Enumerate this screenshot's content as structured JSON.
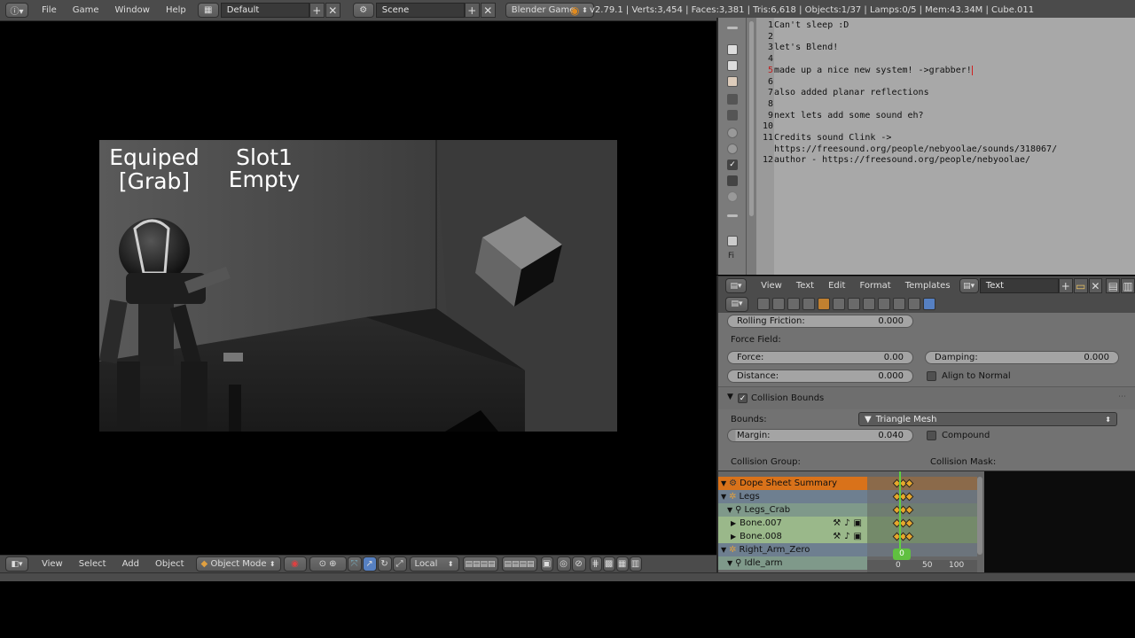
{
  "topbar": {
    "menus": [
      "File",
      "Game",
      "Window",
      "Help"
    ],
    "layout": "Default",
    "scene": "Scene",
    "engine": "Blender Game",
    "stats": "v2.79.1 | Verts:3,454 | Faces:3,381 | Tris:6,618 | Objects:1/37 | Lamps:0/5 | Mem:43.34M | Cube.011"
  },
  "game_view": {
    "hud_equipped_line1": "Equiped",
    "hud_equipped_line2": "[Grab]",
    "hud_slot_line1": "Slot1",
    "hud_slot_line2": "Empty"
  },
  "view_header": {
    "menus": [
      "View",
      "Select",
      "Add",
      "Object"
    ],
    "mode": "Object Mode",
    "orientation": "Local"
  },
  "text_editor": {
    "lines": [
      {
        "num": "1",
        "text": "Can't sleep :D"
      },
      {
        "num": "2",
        "text": ""
      },
      {
        "num": "3",
        "text": "let's Blend!"
      },
      {
        "num": "4",
        "text": ""
      },
      {
        "num": "5",
        "text": "made up a nice new system! ->grabber!"
      },
      {
        "num": "6",
        "text": ""
      },
      {
        "num": "7",
        "text": "also added planar reflections"
      },
      {
        "num": "8",
        "text": ""
      },
      {
        "num": "9",
        "text": "next lets add some sound eh?"
      },
      {
        "num": "10",
        "text": ""
      },
      {
        "num": "11",
        "text": "Credits sound Clink ->"
      },
      {
        "num": "",
        "text": "https://freesound.org/people/nebyoolae/sounds/318067/"
      },
      {
        "num": "12",
        "text": "author - https://freesound.org/people/nebyoolae/"
      }
    ],
    "sidebar_label": "Fi",
    "header_menus": [
      "View",
      "Text",
      "Edit",
      "Format",
      "Templates"
    ],
    "datablock": "Text"
  },
  "properties": {
    "rolling_friction": {
      "label": "Rolling Friction:",
      "value": "0.000"
    },
    "force_field_label": "Force Field:",
    "force": {
      "label": "Force:",
      "value": "0.00"
    },
    "damping": {
      "label": "Damping:",
      "value": "0.000"
    },
    "distance": {
      "label": "Distance:",
      "value": "0.000"
    },
    "align_to_normal": "Align to Normal",
    "collision_bounds": "Collision Bounds",
    "bounds_label": "Bounds:",
    "bounds_value": "Triangle Mesh",
    "margin": {
      "label": "Margin:",
      "value": "0.040"
    },
    "compound": "Compound",
    "collision_group": "Collision Group:",
    "collision_mask": "Collision Mask:"
  },
  "dopesheet": {
    "rows": [
      {
        "label": "Dope Sheet Summary"
      },
      {
        "label": "Legs"
      },
      {
        "label": "Legs_Crab"
      },
      {
        "label": "Bone.007"
      },
      {
        "label": "Bone.008"
      },
      {
        "label": "Right_Arm_Zero"
      },
      {
        "label": "Idle_arm"
      }
    ],
    "current_frame": "0",
    "ruler": [
      "0",
      "50",
      "100"
    ]
  },
  "colors": {
    "accent_orange": "#e08a1e",
    "bg_dark": "#4b4b4b",
    "editor_bg": "#a8a8a8"
  }
}
